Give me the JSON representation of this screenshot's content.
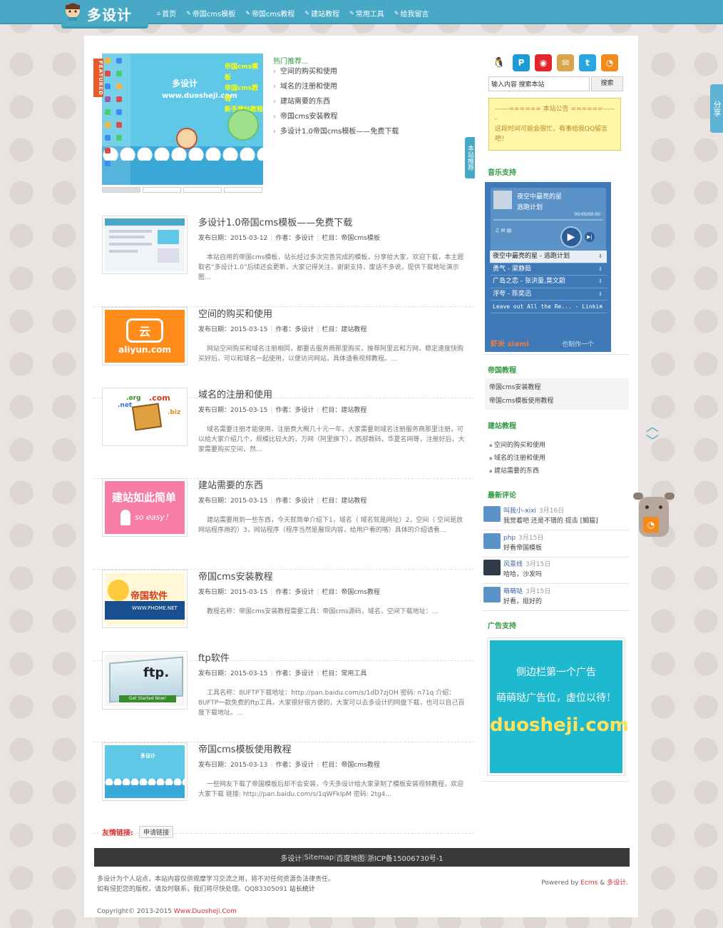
{
  "header": {
    "logo_text": "多设计",
    "nav": [
      {
        "label": "首页",
        "icon": "home-icon"
      },
      {
        "label": "帝国cms模板",
        "icon": "pencil-icon"
      },
      {
        "label": "帝国cms教程",
        "icon": "pencil-icon"
      },
      {
        "label": "建站教程",
        "icon": "pencil-icon"
      },
      {
        "label": "常用工具",
        "icon": "pencil-icon"
      },
      {
        "label": "给我留言",
        "icon": "pencil-icon"
      }
    ]
  },
  "featured": {
    "ribbon": "FEATURED",
    "slide_line1": "多设计",
    "slide_line2": "www.duosheji.com",
    "slide_tags": [
      "帝国cms模板",
      "帝国cms教程",
      "新手建站教程"
    ]
  },
  "hot": {
    "title": "热门推荐...",
    "items": [
      "空间的购买和使用",
      "域名的注册和使用",
      "建站需要的东西",
      "帝国cms安装教程",
      "多设计1.0帝国cms模板——免费下载"
    ]
  },
  "site_recommend_tab": "本站推荐",
  "articles": [
    {
      "title": "多设计1.0帝国cms模板——免费下载",
      "date": "发布日期：2015-03-12",
      "author": "作者：多设计",
      "column": "栏目：帝国cms模板",
      "desc": "本站自用的帝国cms模板，站长经过多次完善完成的模板，分享给大家，欢迎下载，本主题取名“多设计1.0”后续还会更新，大家记得关注，谢谢支持，废话不多说，提供下载地址演示图..."
    },
    {
      "title": "空间的购买和使用",
      "date": "发布日期：2015-03-15",
      "author": "作者：多设计",
      "column": "栏目：建站教程",
      "desc": "网站空间购买和域名注册相同，都要去服务商那里购买，推荐阿里云和万网，稳定速度快购买好后，可以和域名一起使用，以便访问网站，具体请看视频教程。..."
    },
    {
      "title": "域名的注册和使用",
      "date": "发布日期：2015-03-15",
      "author": "作者：多设计",
      "column": "栏目：建站教程",
      "desc": "域名需要注册才能使用，注册费大概几十元一年，大家需要到域名注册服务商那里注册，可以给大家介绍几个，规模比较大的，万网（阿里旗下），西部数码，华夏名网等，注册好后，大家需要购买空间，然..."
    },
    {
      "title": "建站需要的东西",
      "date": "发布日期：2015-03-15",
      "author": "作者：多设计",
      "column": "栏目：建站教程",
      "desc": "建站需要用到一些东西，今天就简单介绍下1，域名（ 域名就是网址）2，空间（ 空间是放网站程序用的）3，网站程序（程序当然是展现内容，给用户看的咯）具体的介绍请看..."
    },
    {
      "title": "帝国cms安装教程",
      "date": "发布日期：2015-03-15",
      "author": "作者：多设计",
      "column": "栏目：帝国cms教程",
      "desc": "教程名称：帝国cms安装教程需要工具：帝国cms源码，域名，空间下载地址：..."
    },
    {
      "title": "ftp软件",
      "date": "发布日期：2015-03-15",
      "author": "作者：多设计",
      "column": "栏目：常用工具",
      "desc": "工具名称：8UFTP下载地址：http://pan.baidu.com/s/1dD7zjOH 密码: n71q 介绍：8UFTP一款免费的ftp工具，大家很好很方便的，大家可以去多设计的网盘下载，也可以自己百度下载地址。..."
    },
    {
      "title": "帝国cms模板使用教程",
      "date": "发布日期：2015-03-13",
      "author": "作者：多设计",
      "column": "栏目：帝国cms教程",
      "desc": "一些网友下载了帝国模板后却不会安装，今天多设计给大家录制了模板安装视频教程，欢迎大家下载 链接: http://pan.baidu.com/s/1qWFkIpM 密码: 2tg4..."
    }
  ],
  "thumbs": {
    "aliyun_text": "aliyun.com",
    "aliyun_glyph": "云",
    "pink_line1": "建站如此简单",
    "pink_line2": "so easy！",
    "empire_text": "帝国软件",
    "empire_url": "WWW.PHOME.NET",
    "ftp_text": "ftp.",
    "ftp_button": "Get Started Now!",
    "box_labels": [
      ".org",
      ".net",
      ".com",
      ".biz"
    ],
    "home_text": "多设计"
  },
  "friend_links": {
    "label": "友情链接:",
    "button": "申请链接"
  },
  "footer": {
    "nav": [
      "多设计",
      "Sitemap",
      "百度地图",
      "浙ICP备15006730号-1"
    ],
    "note_line1": "多设计为个人站点，本站内容仅供观摩学习交流之用，将不对任何资源负法律责任。",
    "note_line2": "如有侵犯您的版权，请及时联系，我们将尽快处理。QQ83305091",
    "stats": "站长统计",
    "powered_prefix": "Powered by",
    "powered_ecms": "Ecms",
    "powered_amp": "&",
    "powered_site": "多设计.",
    "copyright_prefix": "Copyright© 2013-2015",
    "copyright_site": "Www.Duosheji.Com"
  },
  "sidebar": {
    "social_icons": [
      "qq-icon",
      "pinterest-icon",
      "weibo-icon",
      "mail-icon",
      "twitter-icon",
      "rss-icon"
    ],
    "search_value": "输入内容 搜索本站",
    "search_button": "搜索",
    "notice_title": "------====== 本站公告 ======------",
    "notice_body": "这段时间可能会很忙，有事给我QQ留言吧！",
    "music_title": "音乐支持",
    "music": {
      "now_song": "夜空中最亮的星",
      "now_artist": "逃跑计划",
      "time": "00:00/00:00",
      "playlist": [
        "夜空中最亮的星 - 逃跑计划",
        "勇气 - 梁静茹",
        "广岛之恋 - 张洪量,莫文蔚",
        "浮夸 - 陈奕迅",
        "Leave out All the Re... - Linkin"
      ],
      "brand": "虾米 xiami",
      "make": "也制作一个"
    },
    "cms_tut_title": "帝国教程",
    "cms_tut_items": [
      "帝国cms安装教程",
      "帝国cms模板使用教程"
    ],
    "build_title": "建站教程",
    "build_items": [
      "空间的购买和使用",
      "域名的注册和使用",
      "建站需要的东西"
    ],
    "comments_title": "最新评论",
    "comments": [
      {
        "name": "叫我小-xixi",
        "date": "3月16日",
        "text": "我觉着吧 还是不错的 提击 [鲷猫]"
      },
      {
        "name": "php",
        "date": "3月15日",
        "text": "好看帝国模板"
      },
      {
        "name": "风景线",
        "date": "3月15日",
        "text": "哈哈，沙发吗"
      },
      {
        "name": "萌萌哒",
        "date": "3月15日",
        "text": "好看，挺好的"
      }
    ],
    "ad_title": "广告支持",
    "ad_line1": "侧边栏第一个广告",
    "ad_line2": "萌萌哒广告位，虚位以待！",
    "ad_line3": "duosheji.com"
  },
  "float": {
    "share": "分享"
  }
}
